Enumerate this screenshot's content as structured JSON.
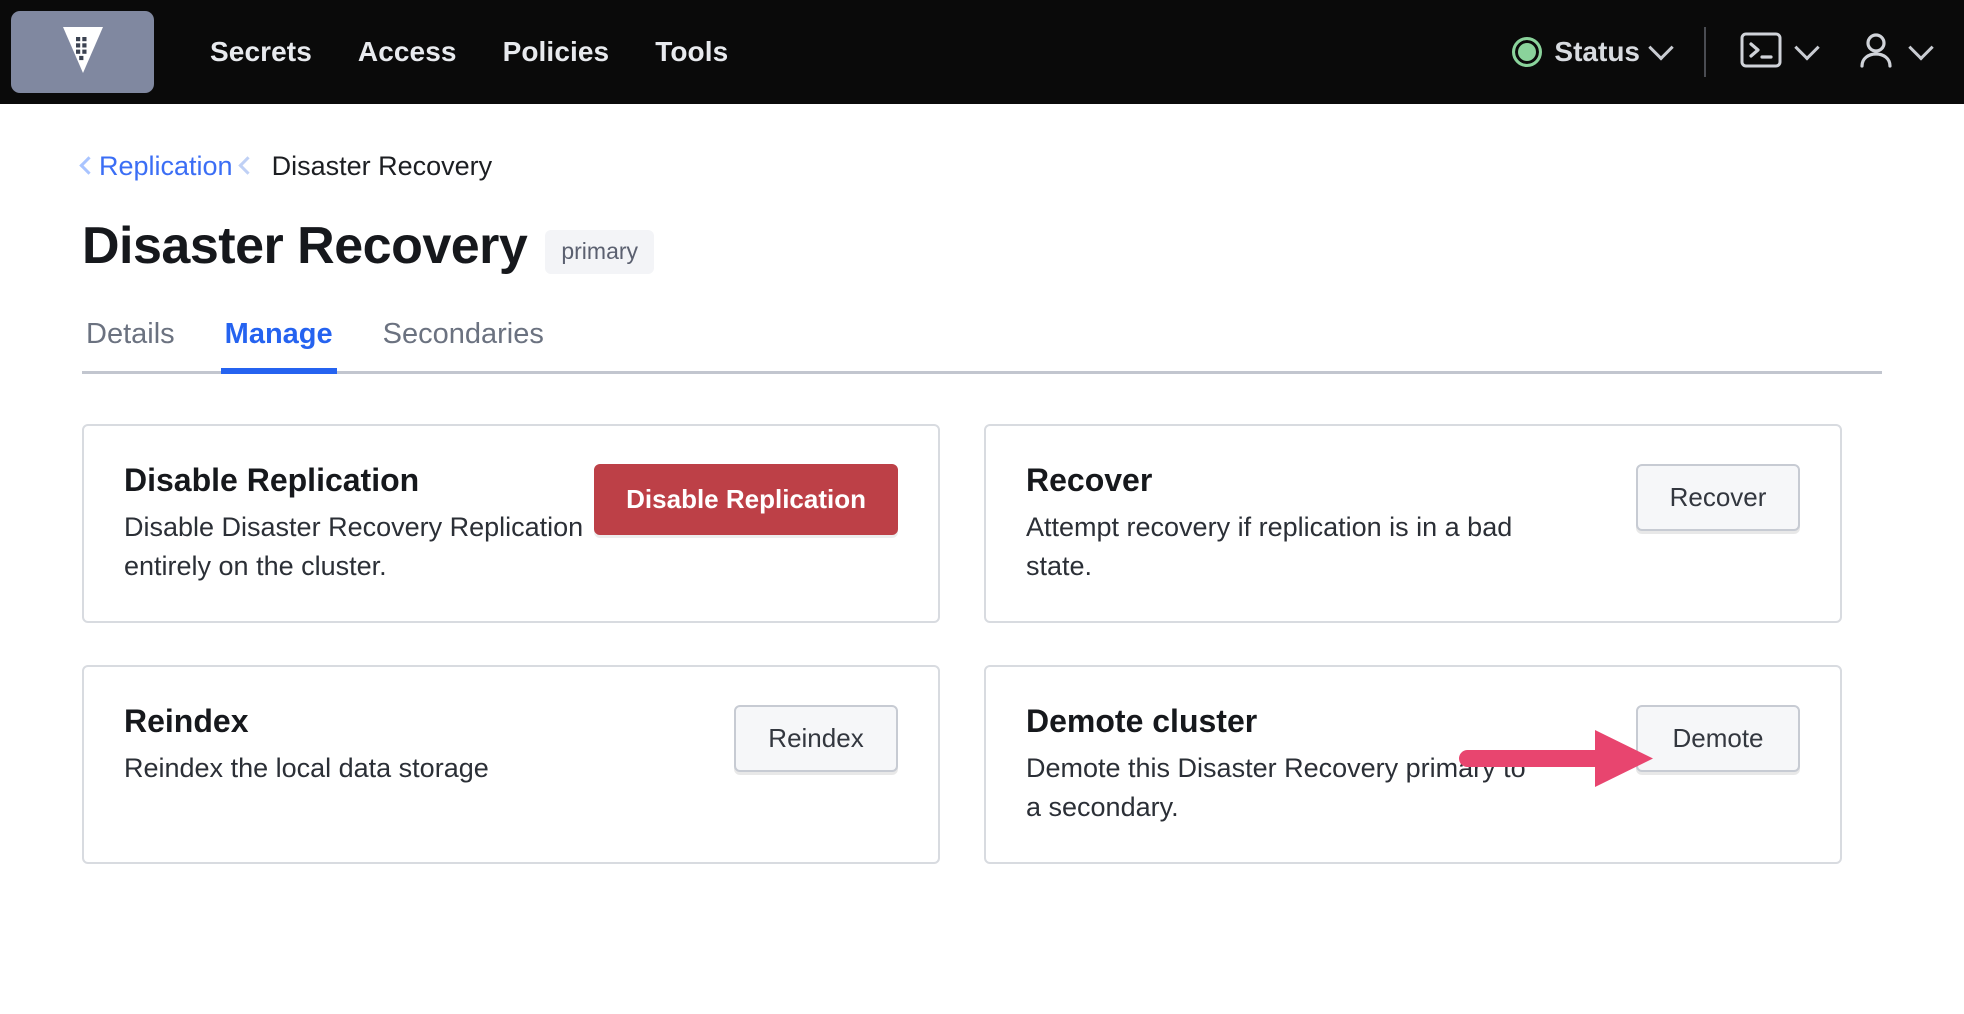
{
  "navbar": {
    "logo_icon": "vault-logo-icon",
    "links": [
      {
        "label": "Secrets"
      },
      {
        "label": "Access"
      },
      {
        "label": "Policies"
      },
      {
        "label": "Tools"
      }
    ],
    "status": {
      "label": "Status",
      "indicator_color": "#8ad39b",
      "chevron_icon": "chevron-down-icon"
    },
    "console_icon": "terminal-icon",
    "console_chevron_icon": "chevron-down-icon",
    "user_icon": "user-icon",
    "user_chevron_icon": "chevron-down-icon"
  },
  "breadcrumb": {
    "parent_label": "Replication",
    "current_label": "Disaster Recovery",
    "chevron_icon": "chevron-left-icon",
    "link_color": "#3b6ef5"
  },
  "header": {
    "title": "Disaster Recovery",
    "badge": "primary"
  },
  "tabs": [
    {
      "label": "Details",
      "active": false
    },
    {
      "label": "Manage",
      "active": true
    },
    {
      "label": "Secondaries",
      "active": false
    }
  ],
  "cards": [
    {
      "title": "Disable Replication",
      "description": "Disable Disaster Recovery Replication entirely on the cluster.",
      "button_label": "Disable Replication",
      "button_style": "danger",
      "button_color": "#bd4047"
    },
    {
      "title": "Recover",
      "description": "Attempt recovery if replication is in a bad state.",
      "button_label": "Recover",
      "button_style": "secondary"
    },
    {
      "title": "Reindex",
      "description": "Reindex the local data storage",
      "button_label": "Reindex",
      "button_style": "secondary"
    },
    {
      "title": "Demote cluster",
      "description": "Demote this Disaster Recovery primary to a secondary.",
      "button_label": "Demote",
      "button_style": "secondary"
    }
  ],
  "annotation": {
    "type": "arrow",
    "color": "#e8456f",
    "points_to": "Demote"
  }
}
